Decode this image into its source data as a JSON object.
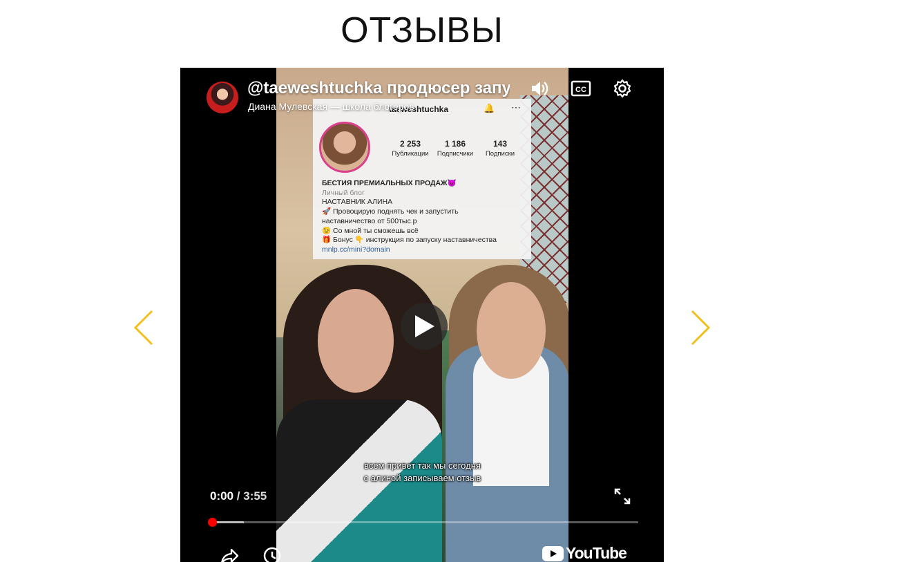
{
  "section_title": "ОТЗЫВЫ",
  "player": {
    "video_title": "@taeweshtuchka продюсер запу",
    "channel_name": "Диана Мулевская — школа блогеров",
    "time_current": "0:00",
    "time_separator": "/",
    "time_duration": "3:55",
    "progress_fraction": 0.0,
    "buffered_fraction": 0.075,
    "captions_line1": "всем привет так мы сегодня",
    "captions_line2": "с алиной записываем отзыв",
    "youtube_logo": "YouTube",
    "icons": [
      "volume-icon",
      "captions-icon",
      "settings-icon",
      "play-icon",
      "fullscreen-icon",
      "share-icon",
      "watch-later-icon",
      "youtube-logo-icon"
    ]
  },
  "instagram_overlay": {
    "handle": "taeweshtuchka",
    "stats": [
      {
        "value": "2 253",
        "label": "Публикации"
      },
      {
        "value": "1 186",
        "label": "Подписчики"
      },
      {
        "value": "143",
        "label": "Подписки"
      }
    ],
    "bio": [
      "БЕСТИЯ ПРЕМИАЛЬНЫХ ПРОДАЖ😈",
      "Личный блог",
      "НАСТАВНИК АЛИНА",
      "🚀 Провоцирую поднять чек и запустить",
      "наставничество от 500тыс.р",
      "😉 Со мной ты сможешь всё",
      "🎁 Бонус 👇 инструкция по запуску наставничества",
      "mnlp.cc/mini?domain"
    ]
  },
  "carousel": {
    "accent_color": "#f2c01e",
    "prev_label": "previous",
    "next_label": "next"
  }
}
